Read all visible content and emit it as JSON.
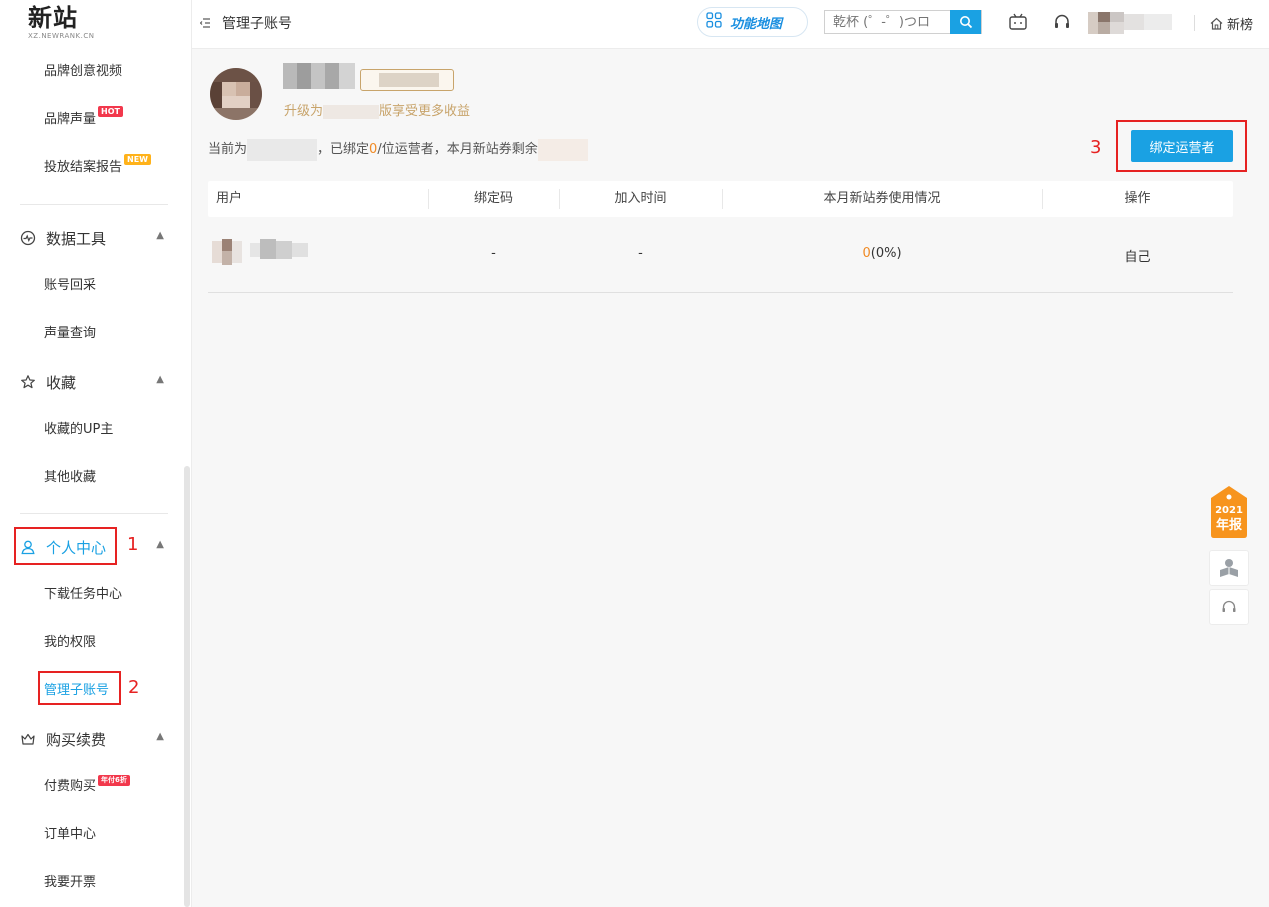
{
  "brand": {
    "logo": "新站",
    "subtitle": "XZ.NEWRANK.CN"
  },
  "sidebar": {
    "top_items": [
      {
        "label": "品牌创意视频",
        "badge": ""
      },
      {
        "label": "品牌声量",
        "badge": "HOT"
      },
      {
        "label": "投放结案报告",
        "badge": "NEW"
      }
    ],
    "groups": [
      {
        "label": "数据工具",
        "icon": "activity-icon",
        "items": [
          "账号回采",
          "声量查询"
        ]
      },
      {
        "label": "收藏",
        "icon": "star-icon",
        "items": [
          "收藏的UP主",
          "其他收藏"
        ]
      },
      {
        "label": "个人中心",
        "icon": "user-icon",
        "items": [
          "下载任务中心",
          "我的权限",
          "管理子账号"
        ]
      },
      {
        "label": "购买续费",
        "icon": "crown-icon",
        "items": [
          "付费购买",
          "订单中心",
          "我要开票"
        ],
        "badge": "年付6折"
      }
    ]
  },
  "annotations": {
    "step1": "1",
    "step2": "2",
    "step3": "3"
  },
  "header": {
    "title": "管理子账号",
    "feature_map": "功能地图",
    "search_placeholder": "乾杯 (゜-゜)つロ",
    "home_label": "新榜"
  },
  "main": {
    "upgrade_text": "升级为",
    "upgrade_suffix": "版享受更多收益",
    "status_prefix": "当前为",
    "status_mid_1": "，已绑定",
    "bound_count": "0",
    "status_mid_2": "/位运营者，本月新站券剩余",
    "bind_button": "绑定运营者"
  },
  "table": {
    "columns": [
      "用户",
      "绑定码",
      "加入时间",
      "本月新站券使用情况",
      "操作"
    ],
    "rows": [
      {
        "bind_code": "-",
        "join_time": "-",
        "usage_count": "0",
        "usage_pct": "(0%)",
        "action": "自己"
      }
    ]
  },
  "floating": {
    "report_year": "2021",
    "report_label": "年报"
  },
  "colors": {
    "accent": "#1aa1e3",
    "annotation": "#e62222",
    "highlight": "#f08a24",
    "gold": "#c8a46b"
  }
}
